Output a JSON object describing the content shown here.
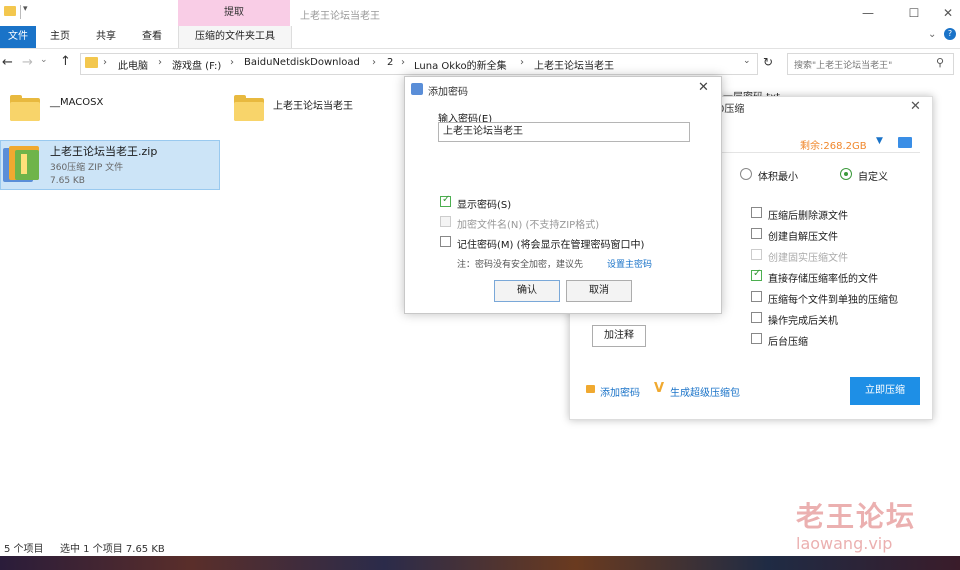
{
  "window": {
    "title": "上老王论坛当老王",
    "context_tab": "提取",
    "controls": [
      "—",
      "☐",
      "✕"
    ]
  },
  "ribbon": {
    "tabs": [
      "文件",
      "主页",
      "共享",
      "查看",
      "压缩的文件夹工具"
    ]
  },
  "address": {
    "crumbs": [
      "此电脑",
      "游戏盘 (F:)",
      "BaiduNetdiskDownload",
      "2",
      "Luna Okko的新全集",
      "上老王论坛当老王"
    ],
    "search_placeholder": "搜索\"上老王论坛当老王\""
  },
  "files": [
    {
      "name": "__MACOSX"
    },
    {
      "name": "上老王论坛当老王"
    },
    {
      "name": "上老王论坛当老王.zip",
      "type": "360压缩 ZIP 文件",
      "size": "7.65 KB"
    }
  ],
  "partial_hidden": {
    "txt_label": "上一层密码.txt",
    "cfg_title_suffix": "0压缩"
  },
  "status": {
    "count": "5 个项目",
    "selected": "选中 1 个项目  7.65 KB"
  },
  "compress_dialog": {
    "free_space": "剩余:268.2GB",
    "radio_small": "体积最小",
    "radio_custom": "自定义",
    "options": [
      {
        "label": "压缩后删除源文件",
        "checked": false,
        "disabled": false
      },
      {
        "label": "创建自解压文件",
        "checked": false,
        "disabled": false
      },
      {
        "label": "创建固实压缩文件",
        "checked": false,
        "disabled": true
      },
      {
        "label": "直接存储压缩率低的文件",
        "checked": true,
        "disabled": false
      },
      {
        "label": "压缩每个文件到单独的压缩包",
        "checked": false,
        "disabled": false
      },
      {
        "label": "操作完成后关机",
        "checked": false,
        "disabled": false
      },
      {
        "label": "后台压缩",
        "checked": false,
        "disabled": false
      }
    ],
    "add_comment": "加注释",
    "add_password": "添加密码",
    "make_super": "生成超级压缩包",
    "compress_now": "立即压缩"
  },
  "password_dialog": {
    "title": "添加密码",
    "label": "输入密码(E)",
    "value": "上老王论坛当老王",
    "show_password": "显示密码(S)",
    "encrypt_names": "加密文件名(N) (不支持ZIP格式)",
    "remember": "记住密码(M) (将会显示在管理密码窗口中)",
    "note": "注：密码没有安全加密，建议先",
    "note_link": "设置主密码",
    "ok": "确认",
    "cancel": "取消"
  },
  "watermark": {
    "text": "老王论坛",
    "url": "laowang.vip"
  },
  "colors": {
    "accent": "#1a73c8",
    "context_tab": "#f9cde6",
    "selection": "#cce4f7",
    "compress_button": "#1e8fe6",
    "free_space": "#f0872b"
  }
}
